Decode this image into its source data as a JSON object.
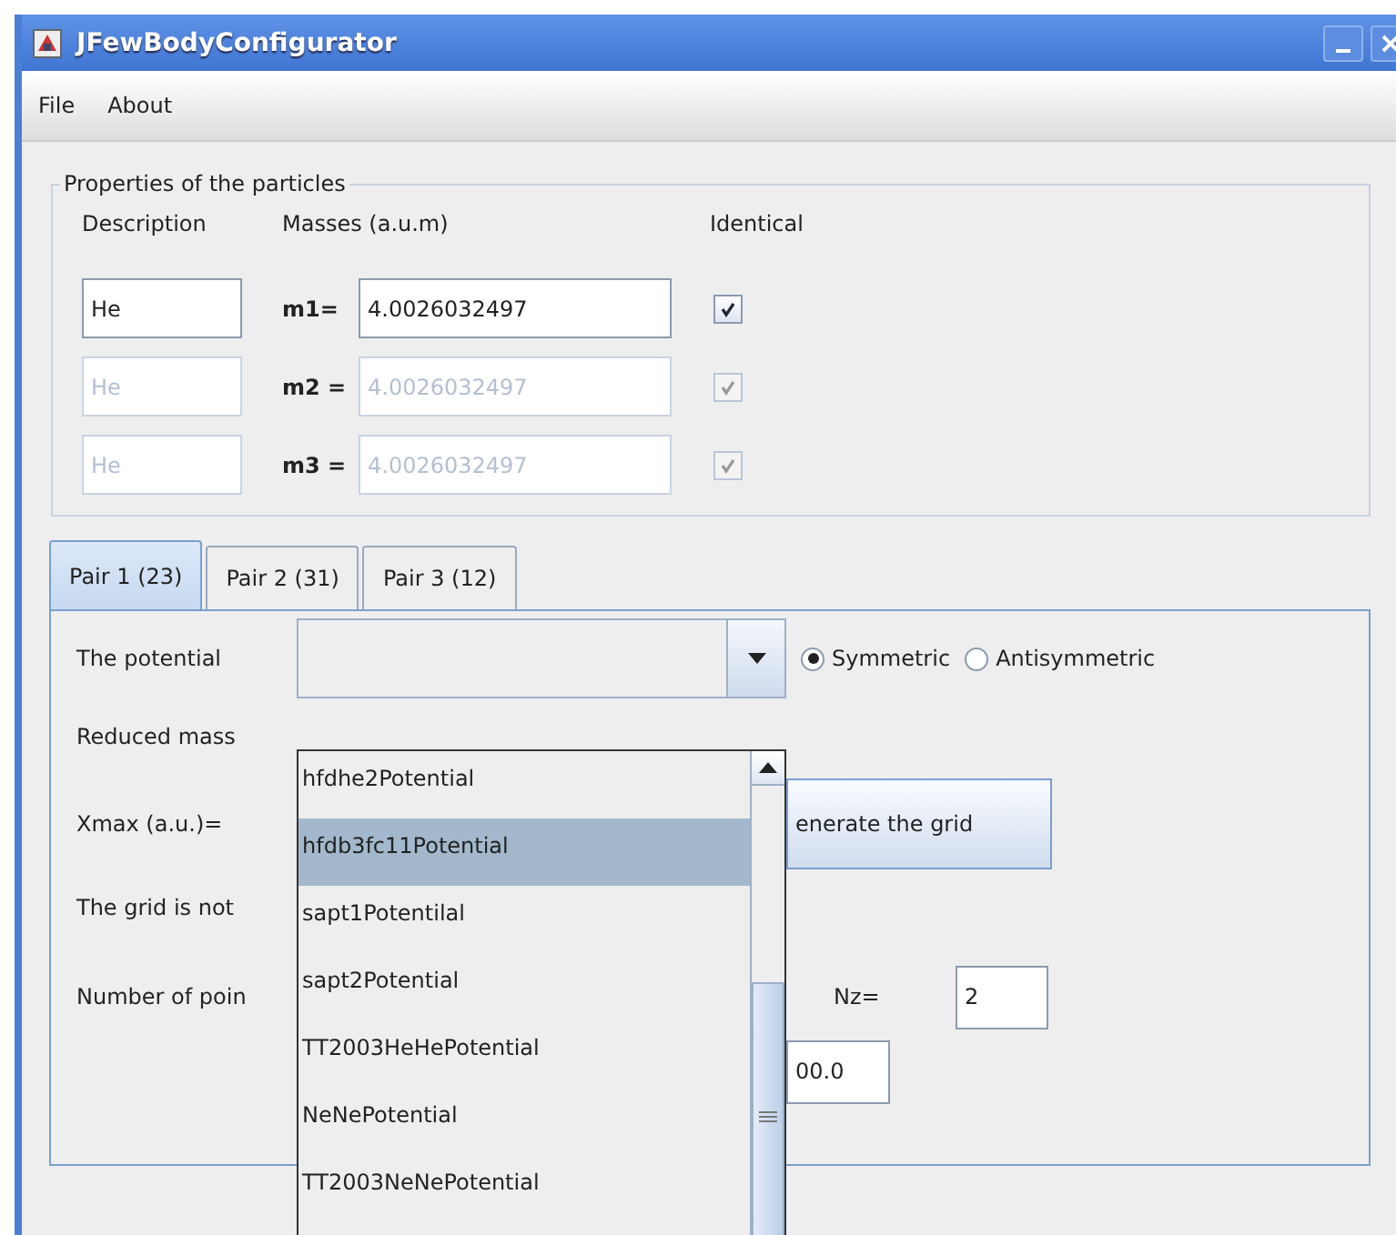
{
  "window": {
    "title": "JFewBodyConfigurator"
  },
  "menu": [
    "File",
    "About"
  ],
  "particles": {
    "title": "Properties of the particles",
    "headers": [
      "Description",
      "Masses (a.u.m)",
      "Identical"
    ],
    "rows": [
      {
        "description": "He",
        "mass_label": "m1=",
        "mass": "4.0026032497",
        "identical": true,
        "disabled": false
      },
      {
        "description": "He",
        "mass_label": "m2 =",
        "mass": "4.0026032497",
        "identical": true,
        "disabled": true
      },
      {
        "description": "He",
        "mass_label": "m3 =",
        "mass": "4.0026032497",
        "identical": true,
        "disabled": true
      }
    ]
  },
  "tabs": [
    {
      "label": "Pair 1 (23)",
      "selected": true
    },
    {
      "label": "Pair 2 (31)",
      "selected": false
    },
    {
      "label": "Pair 3 (12)",
      "selected": false
    }
  ],
  "pair": {
    "potential_label": "The potential",
    "radios": [
      {
        "label": "Symmetric",
        "selected": true
      },
      {
        "label": "Antisymmetric",
        "selected": false
      }
    ],
    "reduced_mass_label": "Reduced mass",
    "xmax_label": "Xmax (a.u.)=",
    "grid_button": "enerate the grid",
    "grid_status": "The grid is not",
    "points_label": "Number of poin",
    "nz_label": "Nz=",
    "nz_value": "2",
    "last_value": "00.0"
  },
  "dropdown": {
    "items": [
      {
        "label": "hfdhe2Potential",
        "selected": false
      },
      {
        "label": "hfdb3fc11Potential",
        "selected": true
      },
      {
        "label": "sapt1Potentilal",
        "selected": false
      },
      {
        "label": "sapt2Potential",
        "selected": false
      },
      {
        "label": "TT2003HeHePotential",
        "selected": false
      },
      {
        "label": "NeNePotential",
        "selected": false
      },
      {
        "label": "TT2003NeNePotential",
        "selected": false
      }
    ]
  }
}
